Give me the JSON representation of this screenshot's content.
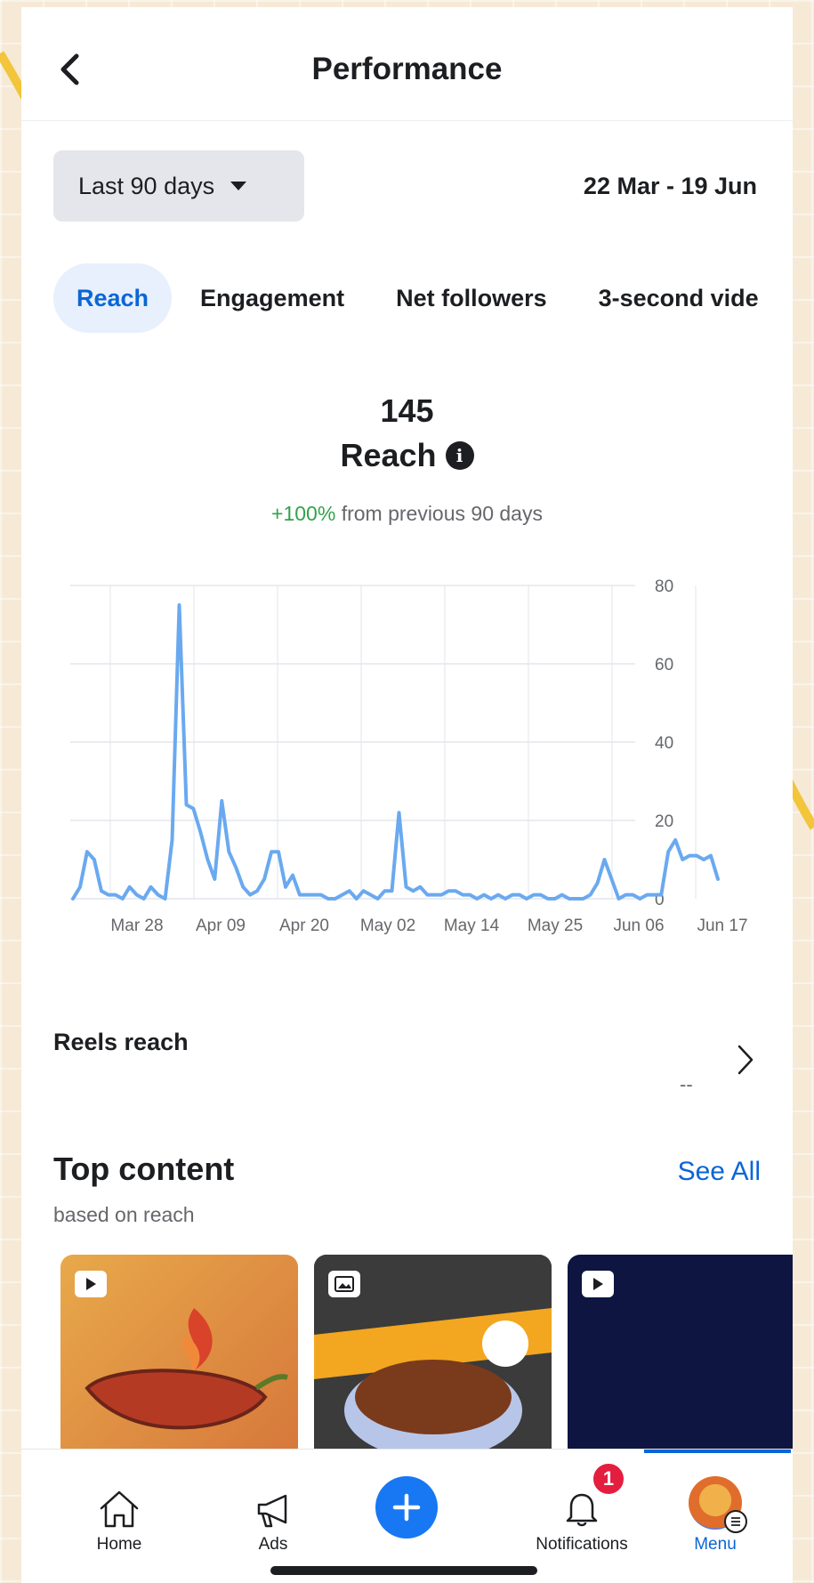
{
  "header": {
    "title": "Performance"
  },
  "period": {
    "selected": "Last 90 days",
    "date_range": "22 Mar - 19 Jun"
  },
  "tabs": [
    {
      "label": "Reach",
      "active": true
    },
    {
      "label": "Engagement",
      "active": false
    },
    {
      "label": "Net followers",
      "active": false
    },
    {
      "label": "3-second vide",
      "active": false
    }
  ],
  "metric": {
    "value": "145",
    "label": "Reach",
    "change_pct": "+100%",
    "change_text": "from previous 90 days"
  },
  "chart_data": {
    "type": "line",
    "color": "#6aa9f0",
    "ylim": [
      0,
      80
    ],
    "yticks": [
      "80",
      "60",
      "40",
      "20",
      "0"
    ],
    "xticks": [
      "Mar 28",
      "Apr 09",
      "Apr 20",
      "May 02",
      "May 14",
      "May 25",
      "Jun 06",
      "Jun 17"
    ],
    "values": [
      0,
      3,
      12,
      10,
      2,
      1,
      1,
      0,
      3,
      1,
      0,
      3,
      1,
      0,
      15,
      75,
      24,
      23,
      17,
      10,
      5,
      25,
      12,
      8,
      3,
      1,
      2,
      5,
      12,
      12,
      3,
      6,
      1,
      1,
      1,
      1,
      0,
      0,
      1,
      2,
      0,
      2,
      1,
      0,
      2,
      2,
      22,
      3,
      2,
      3,
      1,
      1,
      1,
      2,
      2,
      1,
      1,
      0,
      1,
      0,
      1,
      0,
      1,
      1,
      0,
      1,
      1,
      0,
      0,
      1,
      0,
      0,
      0,
      1,
      4,
      10,
      5,
      0,
      1,
      1,
      0,
      1,
      1,
      1,
      12,
      15,
      10,
      11,
      11,
      10,
      11,
      5
    ]
  },
  "reels": {
    "label": "Reels reach",
    "value": "--"
  },
  "top_content": {
    "title": "Top content",
    "see_all": "See All",
    "subtitle": "based on reach"
  },
  "nav": {
    "home": "Home",
    "ads": "Ads",
    "notifications": "Notifications",
    "notification_count": "1",
    "menu": "Menu"
  }
}
